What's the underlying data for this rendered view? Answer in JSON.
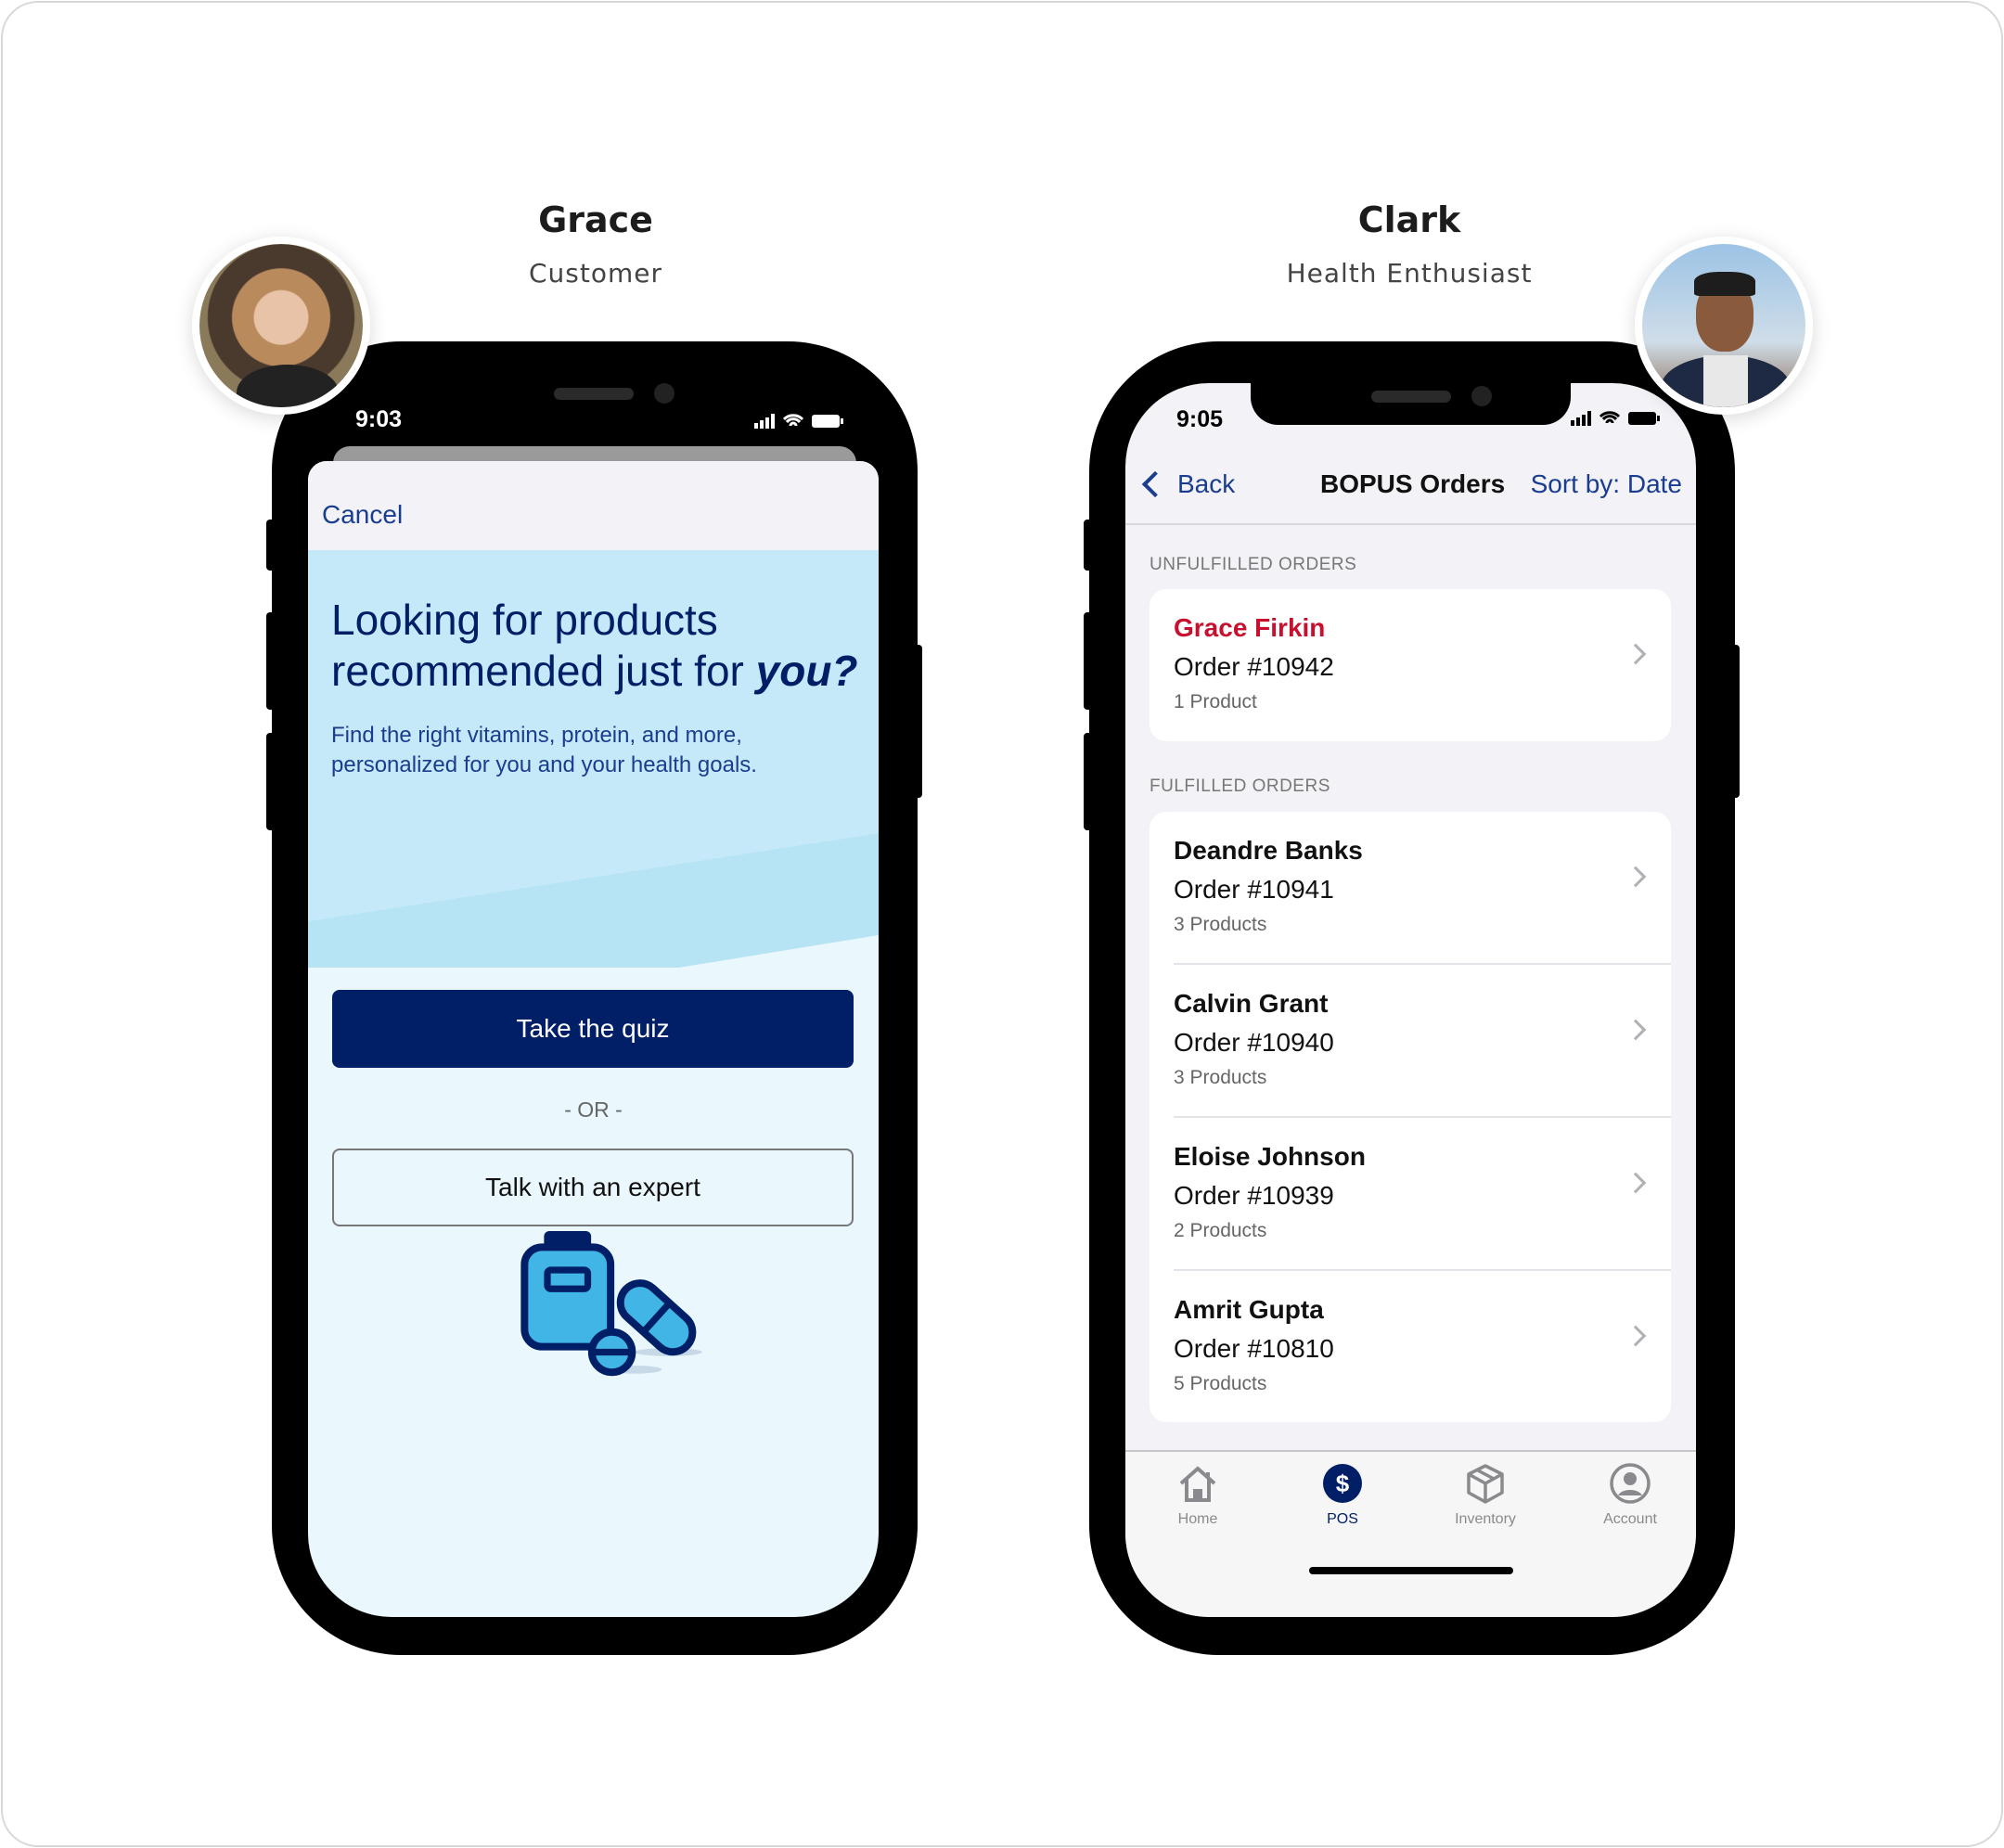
{
  "personas": [
    {
      "name": "Grace",
      "role": "Customer"
    },
    {
      "name": "Clark",
      "role": "Health Enthusiast"
    }
  ],
  "customer_app": {
    "status_time": "9:03",
    "cancel_label": "Cancel",
    "heading_line1": "Looking for products",
    "heading_line2": "recommended just for ",
    "heading_emphasis": "you?",
    "description": "Find the right vitamins, protein, and more, personalized for you and your health goals.",
    "quiz_button": "Take the quiz",
    "or_label": "- OR -",
    "expert_button": "Talk with an expert",
    "colors": {
      "primary": "#001f66",
      "sheet_bg": "#c5e9f8",
      "light_bg": "#eaf7fd",
      "illustration": "#41b6e6"
    }
  },
  "associate_app": {
    "status_time": "9:05",
    "nav": {
      "back_label": "Back",
      "title": "BOPUS Orders",
      "sort_label": "Sort by: Date"
    },
    "unfulfilled_header": "UNFULFILLED ORDERS",
    "unfulfilled": [
      {
        "name": "Grace Firkin",
        "order": "Order #10942",
        "products": "1 Product"
      }
    ],
    "fulfilled_header": "FULFILLED ORDERS",
    "fulfilled": [
      {
        "name": "Deandre Banks",
        "order": "Order #10941",
        "products": "3 Products"
      },
      {
        "name": "Calvin Grant",
        "order": "Order #10940",
        "products": "3 Products"
      },
      {
        "name": "Eloise Johnson",
        "order": "Order #10939",
        "products": "2 Products"
      },
      {
        "name": "Amrit Gupta",
        "order": "Order #10810",
        "products": "5 Products"
      }
    ],
    "tabs": [
      {
        "label": "Home",
        "icon": "house-icon",
        "active": false
      },
      {
        "label": "POS",
        "icon": "dollar-icon",
        "active": true
      },
      {
        "label": "Inventory",
        "icon": "box-icon",
        "active": false
      },
      {
        "label": "Account",
        "icon": "person-circle-icon",
        "active": false
      }
    ],
    "colors": {
      "accent": "#1a3d8f",
      "alert_name": "#c8102e"
    }
  }
}
